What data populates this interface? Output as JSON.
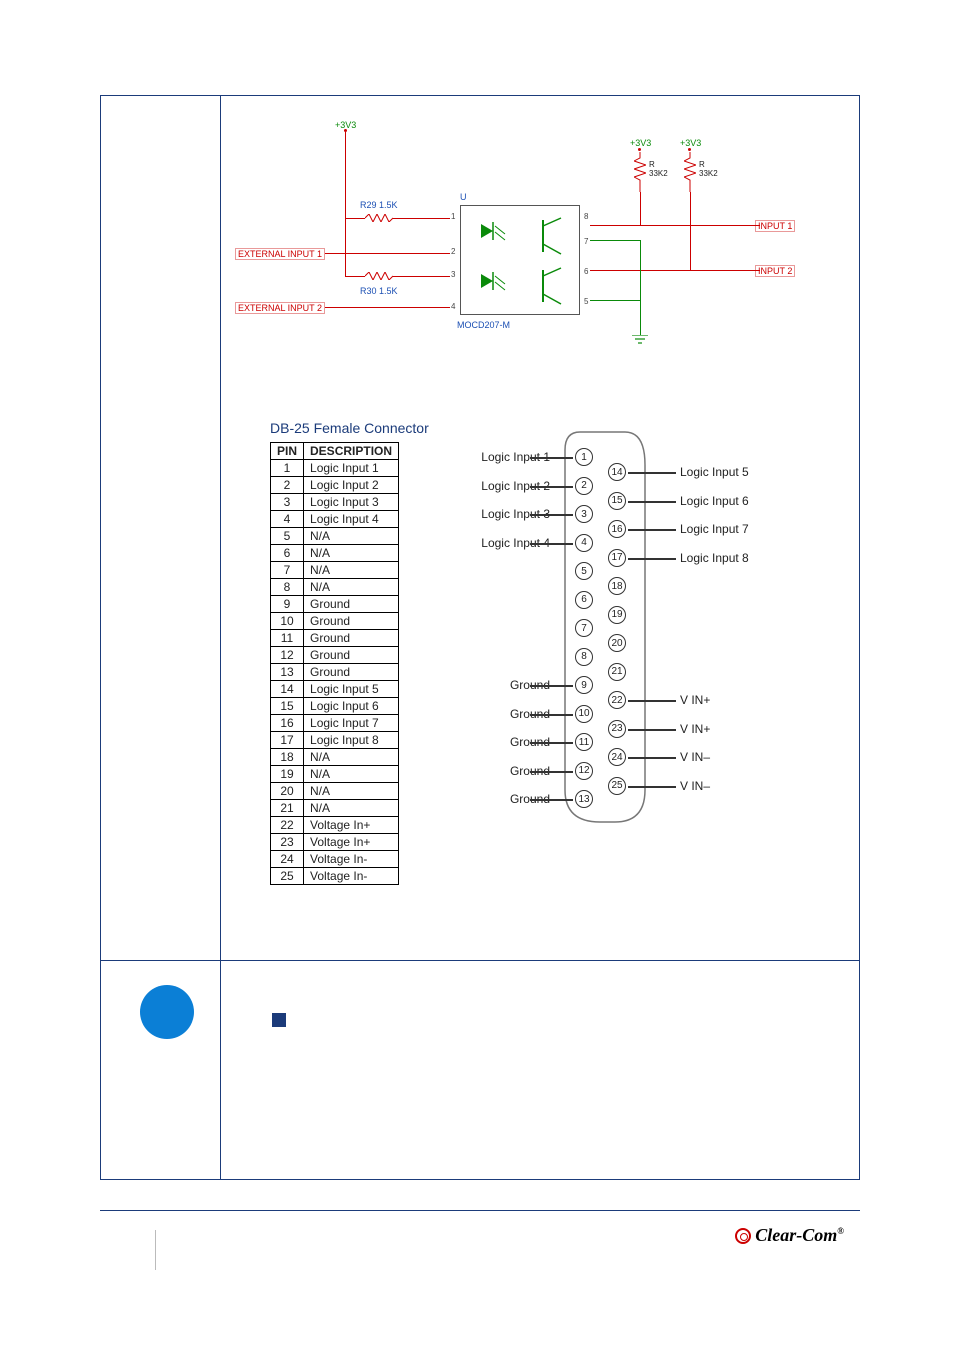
{
  "schematic": {
    "rail": "+3V3",
    "extInput1": "EXTERNAL INPUT 1",
    "extInput2": "EXTERNAL INPUT 2",
    "r29": "R29  1.5K",
    "r30": "R30    1.5K",
    "ic_ref": "U",
    "ic_part": "MOCD207-M",
    "pullup_r": "R\n33K2",
    "out1": "INPUT 1",
    "out2": "INPUT 2",
    "pins": {
      "p1": "1",
      "p2": "2",
      "p3": "3",
      "p4": "4",
      "p5": "5",
      "p6": "6",
      "p7": "7",
      "p8": "8"
    }
  },
  "pinTable": {
    "title": "DB-25 Female Connector",
    "hPin": "PIN",
    "hDesc": "DESCRIPTION",
    "rows": [
      {
        "pin": "1",
        "desc": "Logic Input 1"
      },
      {
        "pin": "2",
        "desc": "Logic Input 2"
      },
      {
        "pin": "3",
        "desc": "Logic Input 3"
      },
      {
        "pin": "4",
        "desc": "Logic Input 4"
      },
      {
        "pin": "5",
        "desc": "N/A"
      },
      {
        "pin": "6",
        "desc": "N/A"
      },
      {
        "pin": "7",
        "desc": "N/A"
      },
      {
        "pin": "8",
        "desc": "N/A"
      },
      {
        "pin": "9",
        "desc": "Ground"
      },
      {
        "pin": "10",
        "desc": "Ground"
      },
      {
        "pin": "11",
        "desc": "Ground"
      },
      {
        "pin": "12",
        "desc": "Ground"
      },
      {
        "pin": "13",
        "desc": "Ground"
      },
      {
        "pin": "14",
        "desc": "Logic Input 5"
      },
      {
        "pin": "15",
        "desc": "Logic Input 6"
      },
      {
        "pin": "16",
        "desc": "Logic Input 7"
      },
      {
        "pin": "17",
        "desc": "Logic Input 8"
      },
      {
        "pin": "18",
        "desc": "N/A"
      },
      {
        "pin": "19",
        "desc": "N/A"
      },
      {
        "pin": "20",
        "desc": "N/A"
      },
      {
        "pin": "21",
        "desc": "N/A"
      },
      {
        "pin": "22",
        "desc": "Voltage In+"
      },
      {
        "pin": "23",
        "desc": "Voltage In+"
      },
      {
        "pin": "24",
        "desc": "Voltage In-"
      },
      {
        "pin": "25",
        "desc": "Voltage In-"
      }
    ]
  },
  "connector": {
    "leftLabels": [
      {
        "text": "Logic Input 1",
        "pin": 1
      },
      {
        "text": "Logic Input 2",
        "pin": 2
      },
      {
        "text": "Logic Input 3",
        "pin": 3
      },
      {
        "text": "Logic Input 4",
        "pin": 4
      },
      {
        "text": "Ground",
        "pin": 9
      },
      {
        "text": "Ground",
        "pin": 10
      },
      {
        "text": "Ground",
        "pin": 11
      },
      {
        "text": "Ground",
        "pin": 12
      },
      {
        "text": "Ground",
        "pin": 13
      }
    ],
    "rightLabels": [
      {
        "text": "Logic Input 5",
        "pin": 14
      },
      {
        "text": "Logic Input 6",
        "pin": 15
      },
      {
        "text": "Logic Input 7",
        "pin": 16
      },
      {
        "text": "Logic Input 8",
        "pin": 17
      },
      {
        "text": "V IN+",
        "pin": 22
      },
      {
        "text": "V IN+",
        "pin": 23
      },
      {
        "text": "V IN–",
        "pin": 24
      },
      {
        "text": "V IN–",
        "pin": 25
      }
    ],
    "leftPins": [
      1,
      2,
      3,
      4,
      5,
      6,
      7,
      8,
      9,
      10,
      11,
      12,
      13
    ],
    "rightPins": [
      14,
      15,
      16,
      17,
      18,
      19,
      20,
      21,
      22,
      23,
      24,
      25
    ]
  },
  "footer": {
    "brand": "Clear-Com",
    "reg": "®"
  }
}
